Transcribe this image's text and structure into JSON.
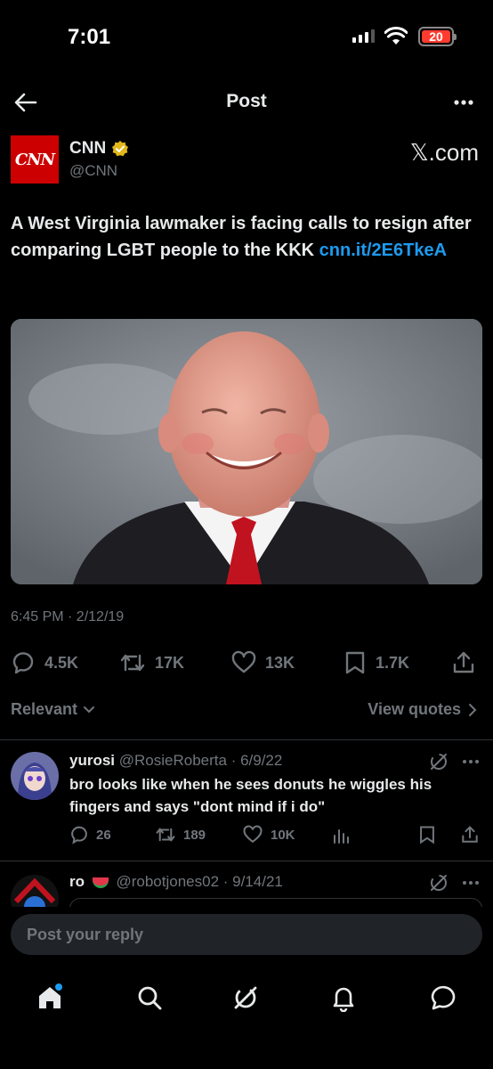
{
  "status_bar": {
    "time": "7:01",
    "battery": "20"
  },
  "header": {
    "title": "Post"
  },
  "author": {
    "logo_text": "CNN",
    "name": "CNN",
    "handle": "@CNN",
    "source": "𝕏.com"
  },
  "post": {
    "text": "A West Virginia lawmaker is facing calls to resign after comparing LGBT people to the KKK ",
    "link": "cnn.it/2E6TkeA",
    "timestamp": "6:45 PM · 2/12/19"
  },
  "actions": {
    "replies": "4.5K",
    "reposts": "17K",
    "likes": "13K",
    "bookmarks": "1.7K"
  },
  "sort": {
    "relevant": "Relevant",
    "view_quotes": "View quotes"
  },
  "replies": [
    {
      "name": "yurosi",
      "handle_date": "@RosieRoberta · 6/9/22",
      "text": "bro looks like when he sees donuts he wiggles his fingers and says \"dont mind if i do\"",
      "replies": "26",
      "reposts": "189",
      "likes": "10K"
    },
    {
      "name": "ro",
      "handle_date": "@robotjones02 · 9/14/21"
    }
  ],
  "compose": {
    "placeholder": "Post your reply"
  },
  "colors": {
    "background": "#000000",
    "text": "#e7e9ea",
    "muted": "#71767b",
    "accent": "#1d9bf0",
    "cnn_red": "#cc0000"
  },
  "icons": {
    "back": "arrow-left-icon",
    "more": "more-horizontal-icon",
    "verified": "verified-badge-icon",
    "reply": "reply-icon",
    "repost": "repost-icon",
    "like": "heart-icon",
    "bookmark": "bookmark-icon",
    "share": "share-icon",
    "grok": "grok-icon",
    "home": "home-icon",
    "search": "search-icon",
    "notifications": "bell-icon",
    "messages": "message-icon"
  }
}
